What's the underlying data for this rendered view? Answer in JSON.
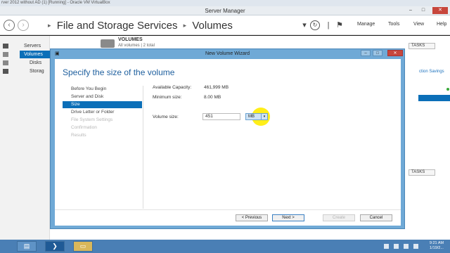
{
  "vbox": {
    "title": "rver 2012 without AD (1) [Running] - Oracle VM VirtualBox"
  },
  "app": {
    "title": "Server Manager",
    "win_controls": {
      "minimize": "–",
      "maximize": "□",
      "close": "✕"
    }
  },
  "header": {
    "breadcrumb": [
      "File and Storage Services",
      "Volumes"
    ],
    "separator": "▸",
    "menu": [
      "Manage",
      "Tools",
      "View",
      "Help"
    ],
    "icons": {
      "back": "back-icon",
      "forward": "forward-icon",
      "refresh": "refresh-icon",
      "notifications": "flag-icon"
    }
  },
  "sidebar": {
    "items": [
      {
        "label": "Servers",
        "active": false
      },
      {
        "label": "Volumes",
        "active": true
      },
      {
        "label": "Disks",
        "active": false
      },
      {
        "label": "Storag",
        "active": false
      }
    ]
  },
  "volumes_panel": {
    "title": "VOLUMES",
    "subtitle": "All volumes | 2 total",
    "tasks_label": "TASKS",
    "right_link": "ction Savings",
    "tasks_label_2": "TASKS"
  },
  "wizard": {
    "title": "New Volume Wizard",
    "heading": "Specify the size of the volume",
    "steps": [
      {
        "label": "Before You Begin",
        "state": "normal"
      },
      {
        "label": "Server and Disk",
        "state": "normal"
      },
      {
        "label": "Size",
        "state": "active"
      },
      {
        "label": "Drive Letter or Folder",
        "state": "normal"
      },
      {
        "label": "File System Settings",
        "state": "disabled"
      },
      {
        "label": "Confirmation",
        "state": "disabled"
      },
      {
        "label": "Results",
        "state": "disabled"
      }
    ],
    "fields": {
      "available_capacity_label": "Available Capacity:",
      "available_capacity_value": "461,999 MB",
      "minimum_size_label": "Minimum size:",
      "minimum_size_value": "8.00 MB",
      "volume_size_label": "Volume size:",
      "volume_size_value": "451",
      "unit_selected": "MB",
      "unit_arrow": "▾"
    },
    "buttons": {
      "previous": "< Previous",
      "next": "Next >",
      "create": "Create",
      "cancel": "Cancel"
    }
  },
  "taskbar": {
    "clock_time": "9:21 AM",
    "clock_date": "1/19/2..."
  },
  "colors": {
    "accent": "#0b6fb8",
    "wizard_frame": "#6fa9d6",
    "heading": "#1e5f9e",
    "cursor_highlight": "#ffec00"
  }
}
